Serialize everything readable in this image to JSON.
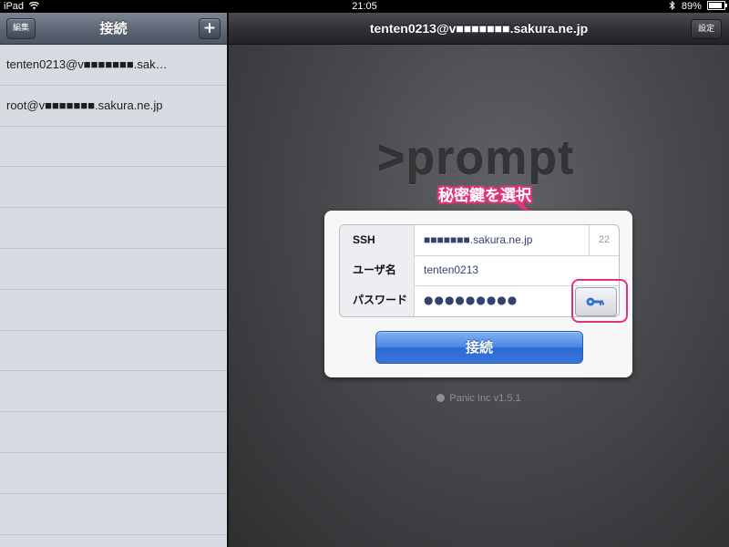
{
  "status_bar": {
    "device": "iPad",
    "time": "21:05",
    "battery": "89%",
    "battery_level": 0.89
  },
  "left_panel": {
    "title": "接続",
    "edit_label": "編集",
    "add_label": "+",
    "connections": [
      "tenten0213@v■■■■■■■.sak…",
      "root@v■■■■■■■.sakura.ne.jp"
    ],
    "empty_rows": 9
  },
  "right_panel": {
    "title": "tenten0213@v■■■■■■■.sakura.ne.jp",
    "settings_label": "設定",
    "logo": ">prompt",
    "annotation": "秘密鍵を選択",
    "form": {
      "ssh_label": "SSH",
      "host_value": "■■■■■■■.sakura.ne.jp",
      "port_value": "22",
      "username_label": "ユーザ名",
      "username_value": "tenten0213",
      "password_label": "パスワード",
      "password_value": "●●●●●●●●●"
    },
    "connect_label": "接続",
    "version": "Panic Inc v1.5.1"
  },
  "colors": {
    "accent_pink": "#e4337b",
    "button_blue": "#3674dc",
    "key_blue": "#2f6fd0"
  }
}
